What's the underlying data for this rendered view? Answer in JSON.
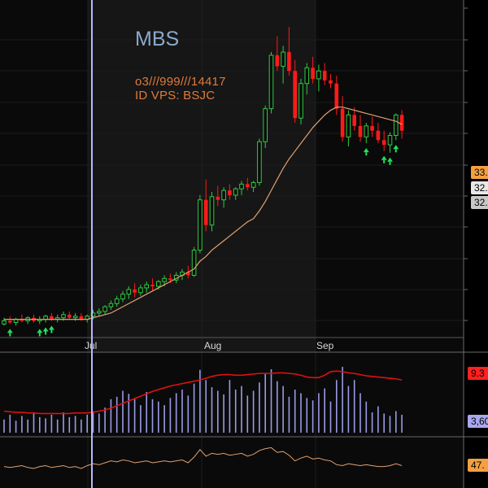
{
  "symbol": "MBS",
  "info_line1": "o3///999///14417",
  "info_line2": "ID VPS: BSJC",
  "price_labels": {
    "ma": "33.",
    "close": "32.",
    "prev": "32."
  },
  "volume_ma_label": "9.3",
  "volume_label": "3,60",
  "rsi_label": "47.",
  "chart_data": {
    "type": "candlestick",
    "x_labels": [
      "Jul",
      "Aug",
      "Sep"
    ],
    "colors": {
      "up": "#2ecc40",
      "down": "#ff1a1a",
      "ma": "#e0a070",
      "volume": "#9a9ae6",
      "volume_ma": "#e01010",
      "rsi": "#e0a070",
      "buy_arrow": "#21e05a",
      "cursor": "#b8b8ff",
      "tag_ma": "#f5a040",
      "tag_close": "#e8e8e8",
      "tag_prev": "#c8c8c8",
      "tag_vol_ma": "#ff2020",
      "tag_vol": "#a8a8f0",
      "tag_rsi": "#f5a040"
    },
    "price": {
      "series_ohlc": [
        [
          20.3,
          20.7,
          20.2,
          20.5
        ],
        [
          20.5,
          20.8,
          20.3,
          20.4
        ],
        [
          20.4,
          20.7,
          20.2,
          20.6
        ],
        [
          20.6,
          20.9,
          20.4,
          20.5
        ],
        [
          20.5,
          20.8,
          20.3,
          20.7
        ],
        [
          20.7,
          20.9,
          20.4,
          20.5
        ],
        [
          20.5,
          20.8,
          20.3,
          20.6
        ],
        [
          20.6,
          20.9,
          20.4,
          20.8
        ],
        [
          20.8,
          21.0,
          20.5,
          20.6
        ],
        [
          20.6,
          20.9,
          20.4,
          20.7
        ],
        [
          20.7,
          21.1,
          20.5,
          20.9
        ],
        [
          20.9,
          21.1,
          20.6,
          20.7
        ],
        [
          20.7,
          21.0,
          20.5,
          20.8
        ],
        [
          20.8,
          21.0,
          20.5,
          20.6
        ],
        [
          20.6,
          20.9,
          20.4,
          20.8
        ],
        [
          20.8,
          21.2,
          20.6,
          21.0
        ],
        [
          21.0,
          21.3,
          20.8,
          21.1
        ],
        [
          21.1,
          21.5,
          20.9,
          21.4
        ],
        [
          21.4,
          21.8,
          21.2,
          21.6
        ],
        [
          21.6,
          22.1,
          21.4,
          21.9
        ],
        [
          21.9,
          22.4,
          21.7,
          22.2
        ],
        [
          22.2,
          22.7,
          21.9,
          22.5
        ],
        [
          22.5,
          22.9,
          22.0,
          22.3
        ],
        [
          22.3,
          22.8,
          22.1,
          22.6
        ],
        [
          22.6,
          23.0,
          22.3,
          22.8
        ],
        [
          22.8,
          23.2,
          22.4,
          22.7
        ],
        [
          22.7,
          23.1,
          22.5,
          23.0
        ],
        [
          23.0,
          23.4,
          22.7,
          23.2
        ],
        [
          23.2,
          23.5,
          22.9,
          23.1
        ],
        [
          23.1,
          23.6,
          22.9,
          23.4
        ],
        [
          23.4,
          23.8,
          23.1,
          23.6
        ],
        [
          23.6,
          24.0,
          23.2,
          23.4
        ],
        [
          23.4,
          25.2,
          23.3,
          25.0
        ],
        [
          25.0,
          28.5,
          24.8,
          28.2
        ],
        [
          28.2,
          29.5,
          26.2,
          26.6
        ],
        [
          26.6,
          28.7,
          26.2,
          28.4
        ],
        [
          28.4,
          29.1,
          27.8,
          28.2
        ],
        [
          28.2,
          29.0,
          27.7,
          28.8
        ],
        [
          28.8,
          29.2,
          28.2,
          28.5
        ],
        [
          28.5,
          29.0,
          28.2,
          28.9
        ],
        [
          28.9,
          29.4,
          28.5,
          29.2
        ],
        [
          29.2,
          29.6,
          28.8,
          29.0
        ],
        [
          29.0,
          29.4,
          28.7,
          29.3
        ],
        [
          29.3,
          32.1,
          29.1,
          31.9
        ],
        [
          31.9,
          34.2,
          31.5,
          34.0
        ],
        [
          34.0,
          37.6,
          33.7,
          37.4
        ],
        [
          37.4,
          38.6,
          36.4,
          36.7
        ],
        [
          36.7,
          38.0,
          35.6,
          37.6
        ],
        [
          37.6,
          39.2,
          36.1,
          36.4
        ],
        [
          36.4,
          37.1,
          33.1,
          33.4
        ],
        [
          33.4,
          35.9,
          33.0,
          35.6
        ],
        [
          35.6,
          36.9,
          34.9,
          36.6
        ],
        [
          36.6,
          37.3,
          35.6,
          35.9
        ],
        [
          35.9,
          36.8,
          35.1,
          36.4
        ],
        [
          36.4,
          36.9,
          35.5,
          35.8
        ],
        [
          35.8,
          36.2,
          35.3,
          35.6
        ],
        [
          35.6,
          36.1,
          33.6,
          34.0
        ],
        [
          34.0,
          34.8,
          31.9,
          32.2
        ],
        [
          32.2,
          33.9,
          31.6,
          33.6
        ],
        [
          33.6,
          34.1,
          32.6,
          32.9
        ],
        [
          32.9,
          33.6,
          31.9,
          32.2
        ],
        [
          32.2,
          33.1,
          31.8,
          32.9
        ],
        [
          32.9,
          33.5,
          32.2,
          32.6
        ],
        [
          32.6,
          33.1,
          31.8,
          32.0
        ],
        [
          32.0,
          32.6,
          31.3,
          31.7
        ],
        [
          31.7,
          32.5,
          31.2,
          32.3
        ],
        [
          32.3,
          33.7,
          32.0,
          33.6
        ],
        [
          33.6,
          33.9,
          32.1,
          32.6
        ]
      ],
      "ma": [
        20.6,
        20.6,
        20.6,
        20.6,
        20.6,
        20.6,
        20.6,
        20.6,
        20.6,
        20.6,
        20.6,
        20.6,
        20.6,
        20.6,
        20.6,
        20.7,
        20.8,
        20.9,
        21.0,
        21.2,
        21.4,
        21.6,
        21.8,
        22.0,
        22.2,
        22.4,
        22.6,
        22.8,
        23.0,
        23.2,
        23.4,
        23.6,
        23.8,
        24.3,
        24.6,
        25.0,
        25.3,
        25.6,
        25.9,
        26.2,
        26.5,
        26.8,
        27.0,
        27.5,
        28.1,
        28.8,
        29.5,
        30.2,
        30.8,
        31.3,
        31.8,
        32.3,
        32.8,
        33.2,
        33.6,
        33.9,
        34.1,
        34.1,
        34.0,
        33.9,
        33.8,
        33.7,
        33.6,
        33.5,
        33.4,
        33.3,
        33.2,
        33.0
      ],
      "buy_signals": [
        1,
        6,
        7,
        8,
        61,
        64,
        65,
        66
      ],
      "y_range": [
        19.7,
        40.5
      ]
    },
    "volume": {
      "values": [
        2.2,
        3.0,
        2.0,
        2.8,
        2.2,
        3.2,
        2.6,
        2.4,
        3.0,
        2.2,
        3.4,
        2.6,
        2.8,
        2.2,
        3.0,
        3.6,
        3.2,
        4.2,
        5.6,
        6.0,
        7.0,
        6.5,
        5.6,
        4.6,
        6.8,
        5.6,
        5.2,
        4.6,
        5.8,
        6.6,
        7.2,
        6.2,
        8.2,
        10.5,
        8.8,
        7.6,
        7.0,
        6.4,
        8.8,
        7.2,
        7.8,
        6.2,
        7.0,
        8.4,
        9.8,
        10.6,
        8.6,
        7.8,
        6.0,
        7.2,
        6.6,
        5.8,
        5.4,
        6.6,
        7.4,
        5.2,
        8.8,
        11.0,
        7.8,
        8.8,
        6.6,
        5.2,
        3.4,
        4.4,
        3.2,
        2.8,
        3.6,
        3.0
      ],
      "ma": [
        3.6,
        3.5,
        3.4,
        3.4,
        3.3,
        3.3,
        3.2,
        3.2,
        3.2,
        3.2,
        3.2,
        3.2,
        3.3,
        3.3,
        3.3,
        3.4,
        3.6,
        3.8,
        4.1,
        4.5,
        4.9,
        5.3,
        5.7,
        6.1,
        6.5,
        6.9,
        7.2,
        7.5,
        7.8,
        8.0,
        8.2,
        8.4,
        8.6,
        8.8,
        9.1,
        9.4,
        9.6,
        9.7,
        9.7,
        9.6,
        9.6,
        9.7,
        9.8,
        9.9,
        9.9,
        9.9,
        10.0,
        10.0,
        9.9,
        9.8,
        9.6,
        9.3,
        9.2,
        9.2,
        9.6,
        10.2,
        10.3,
        10.2,
        10.0,
        9.9,
        9.7,
        9.5,
        9.4,
        9.3,
        9.2,
        9.1,
        9.0,
        8.8
      ],
      "y_range": [
        0,
        12.5
      ]
    },
    "rsi": {
      "values": [
        46,
        45,
        46,
        47,
        45,
        44,
        46,
        47,
        45,
        46,
        47,
        45,
        46,
        44,
        47,
        49,
        48,
        50,
        52,
        51,
        53,
        52,
        50,
        51,
        52,
        50,
        51,
        52,
        51,
        52,
        53,
        50,
        56,
        64,
        57,
        60,
        59,
        60,
        58,
        59,
        60,
        57,
        59,
        63,
        65,
        66,
        61,
        62,
        58,
        52,
        55,
        57,
        54,
        55,
        53,
        52,
        48,
        47,
        49,
        48,
        47,
        48,
        47,
        46,
        46,
        47,
        49,
        47
      ],
      "y_range": [
        25,
        75
      ]
    }
  }
}
